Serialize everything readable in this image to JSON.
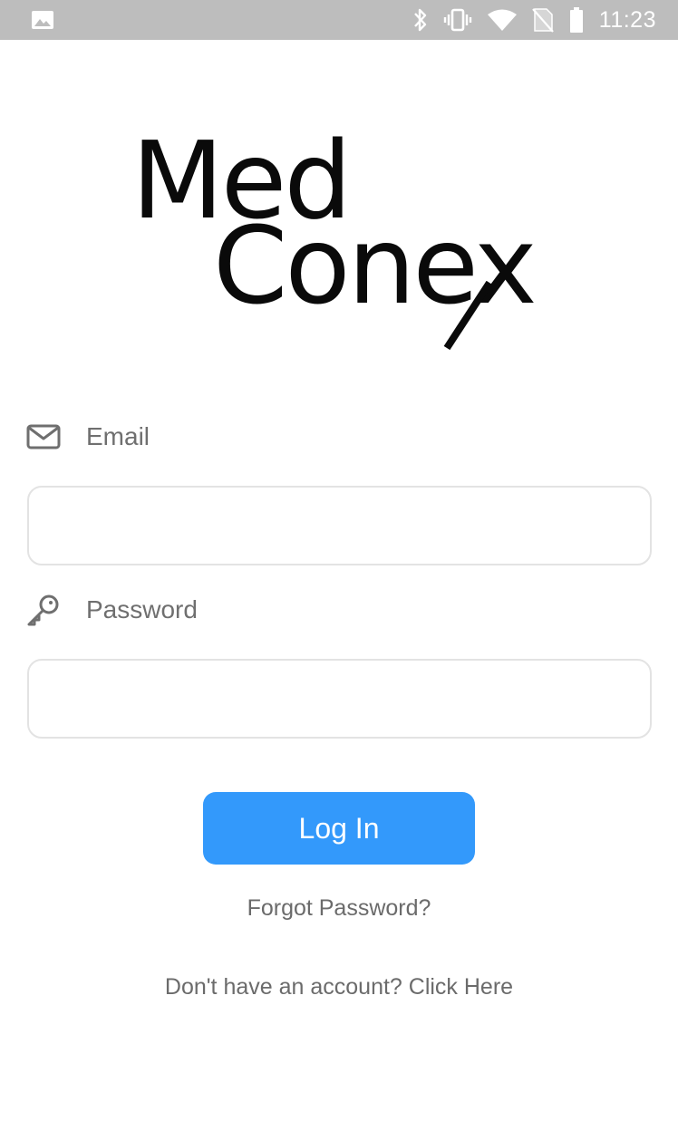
{
  "status_bar": {
    "time": "11:23",
    "icons": [
      "image-icon",
      "bluetooth-icon",
      "vibrate-icon",
      "wifi-icon",
      "no-sim-icon",
      "battery-icon"
    ],
    "background": "#bdbdbd"
  },
  "logo": {
    "line1": "Med",
    "line2": "Conex"
  },
  "form": {
    "email_label": "Email",
    "email_value": "",
    "password_label": "Password",
    "password_value": "",
    "login_label": "Log In",
    "forgot_label": "Forgot Password?",
    "signup_label": "Don't have an account? Click Here"
  },
  "colors": {
    "accent": "#3399fb",
    "label_text": "#6f6f6f",
    "input_border": "#e3e3e3"
  }
}
